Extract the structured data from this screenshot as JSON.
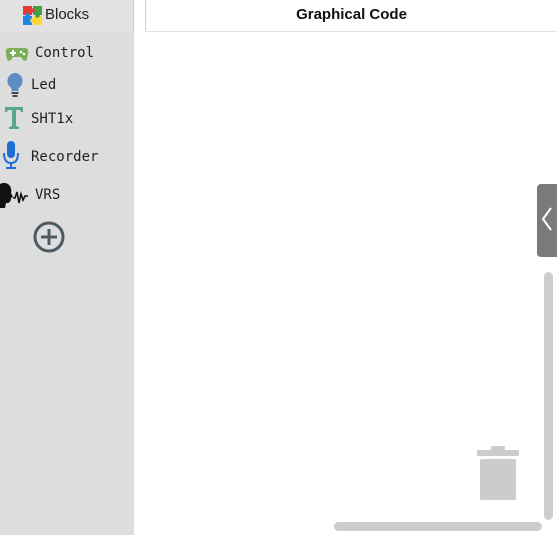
{
  "tabs": {
    "blocks_label": "Blocks",
    "code_label": "Graphical Code"
  },
  "toolbox": {
    "categories": [
      {
        "label": "Control",
        "icon": "gamepad-icon"
      },
      {
        "label": "Led",
        "icon": "lightbulb-icon"
      },
      {
        "label": "SHT1x",
        "icon": "text-t-icon"
      },
      {
        "label": "Recorder",
        "icon": "microphone-icon"
      },
      {
        "label": "VRS",
        "icon": "voice-head-icon"
      }
    ],
    "add_icon": "plus-circle-icon"
  },
  "workspace": {
    "toggle_icon": "chevron-left-icon",
    "trash_icon": "trash-icon"
  },
  "colors": {
    "sidebar_bg": "#dddddd",
    "toggle_bg": "#7a7a7a",
    "scrollbar": "#cdcdcd",
    "trash": "#cccccc"
  }
}
